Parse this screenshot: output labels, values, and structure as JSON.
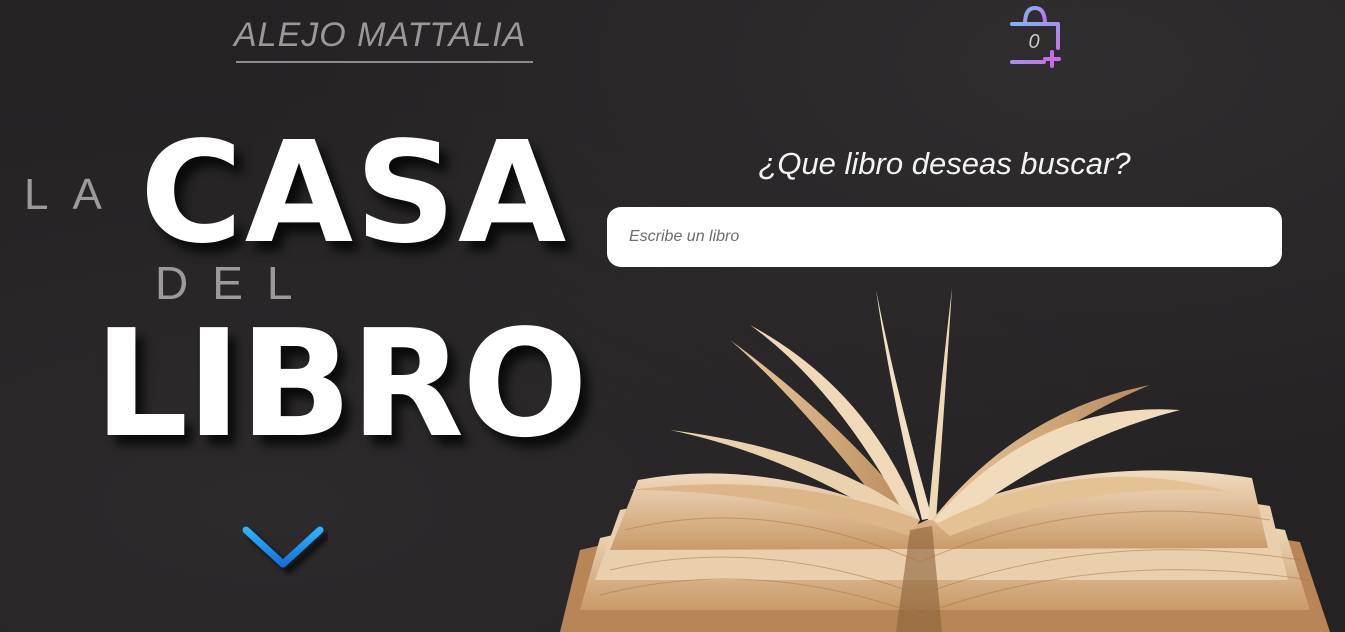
{
  "header": {
    "author": "ALEJO MATTALIA",
    "cart_count": "0"
  },
  "logo": {
    "la": "LA",
    "casa": "CASA",
    "del": "DEL",
    "libro": "LIBRO"
  },
  "search": {
    "title": "¿Que libro deseas buscar?",
    "placeholder": "Escribe un libro",
    "value": ""
  },
  "icons": {
    "cart": "shopping-bag-add-icon",
    "scroll": "chevron-down-icon"
  },
  "colors": {
    "background": "#242223",
    "chevron": "#1e9bf0",
    "bag_gradient_start": "#7fb5f5",
    "bag_gradient_end": "#c86ce8"
  }
}
